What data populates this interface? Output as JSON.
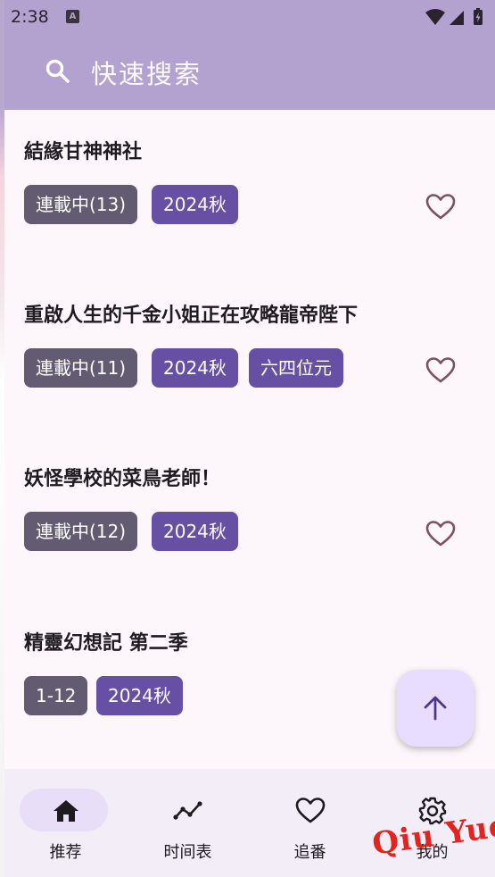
{
  "status_bar": {
    "time": "2:38",
    "notif_glyph": "A"
  },
  "header": {
    "search_placeholder": "快速搜索",
    "search_icon": "search-icon"
  },
  "anime_list": [
    {
      "title": "結緣甘神神社",
      "tags": [
        {
          "text": "連載中(13)",
          "style": "grey"
        },
        {
          "text": "2024秋",
          "style": "purple"
        }
      ],
      "favorited": false
    },
    {
      "title": "重啟人生的千金小姐正在攻略龍帝陛下",
      "tags": [
        {
          "text": "連載中(11)",
          "style": "grey"
        },
        {
          "text": "2024秋",
          "style": "purple"
        },
        {
          "text": "六四位元",
          "style": "purple"
        }
      ],
      "favorited": false
    },
    {
      "title": "妖怪學校的菜鳥老師！",
      "tags": [
        {
          "text": "連載中(12)",
          "style": "grey"
        },
        {
          "text": "2024秋",
          "style": "purple"
        }
      ],
      "favorited": false
    },
    {
      "title": "精靈幻想記 第二季",
      "tags": [
        {
          "text": "1-12",
          "style": "grey"
        },
        {
          "text": "2024秋",
          "style": "purple"
        }
      ],
      "favorited": false
    }
  ],
  "fab": {
    "icon": "arrow-up-icon"
  },
  "bottom_nav": [
    {
      "label": "推荐",
      "icon": "home-icon",
      "selected": true
    },
    {
      "label": "时间表",
      "icon": "timeline-icon",
      "selected": false
    },
    {
      "label": "追番",
      "icon": "heart-icon",
      "selected": false
    },
    {
      "label": "我的",
      "icon": "gear-icon",
      "selected": false
    }
  ],
  "watermark": "Qiu Yue",
  "colors": {
    "topbar": "#b3a2d0",
    "chip_grey": "#625b71",
    "chip_purple": "#6750a4",
    "nav_pill": "#e8def8",
    "heart": "#7d5260"
  }
}
